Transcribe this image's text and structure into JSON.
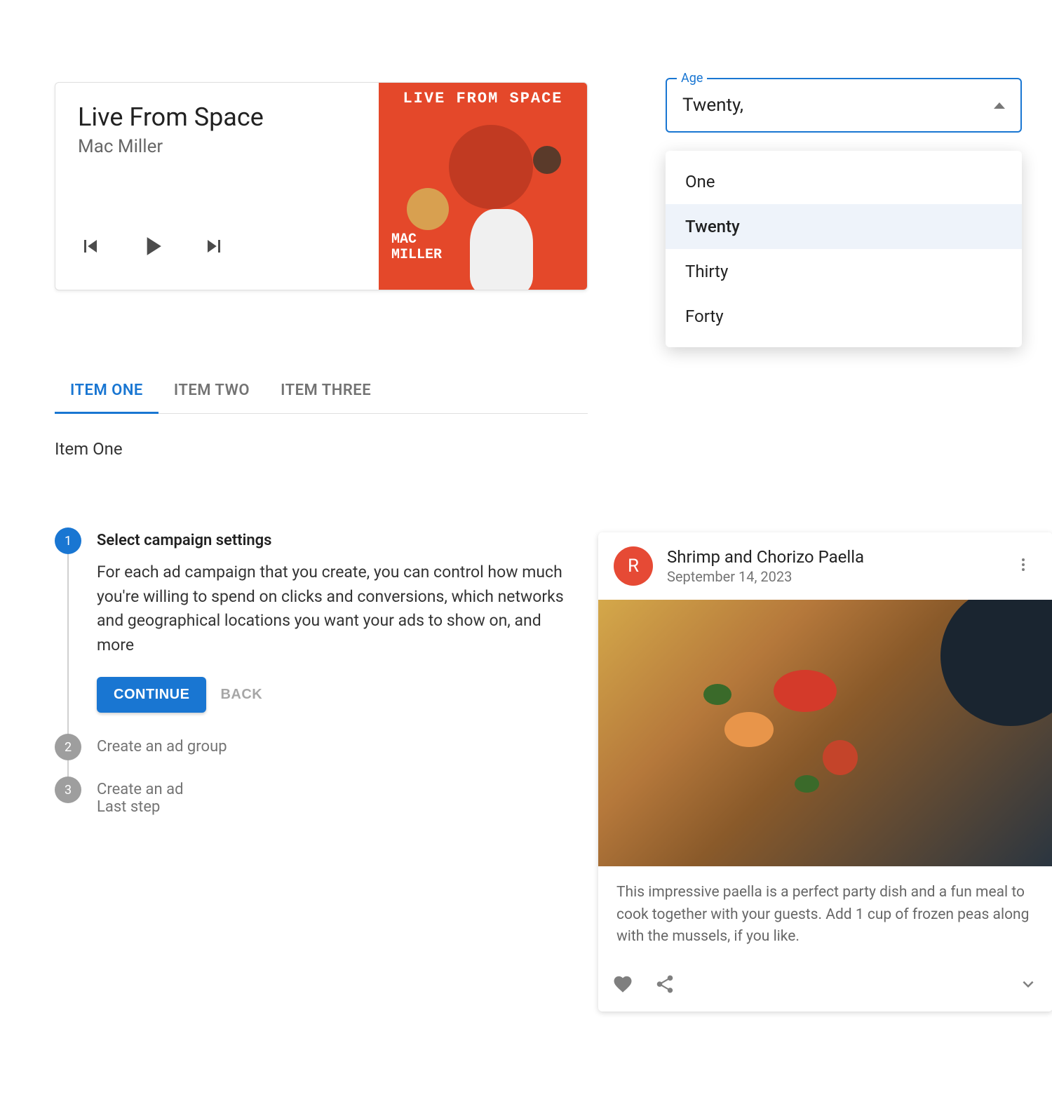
{
  "music": {
    "title": "Live From Space",
    "artist": "Mac Miller",
    "album_art_title": "LIVE FROM SPACE",
    "album_art_artist": "MAC\nMILLER"
  },
  "select": {
    "label": "Age",
    "value": "Twenty,",
    "options": [
      "One",
      "Twenty",
      "Thirty",
      "Forty"
    ],
    "selected_index": 1
  },
  "tabs": {
    "items": [
      "ITEM ONE",
      "ITEM TWO",
      "ITEM THREE"
    ],
    "active_index": 0,
    "panel": "Item One"
  },
  "stepper": {
    "steps": [
      {
        "num": "1",
        "title": "Select campaign settings",
        "content": "For each ad campaign that you create, you can control how much you're willing to spend on clicks and conversions, which networks and geographical locations you want your ads to show on, and more",
        "active": true
      },
      {
        "num": "2",
        "title": "Create an ad group"
      },
      {
        "num": "3",
        "title": "Create an ad",
        "subtitle": "Last step"
      }
    ],
    "continue_label": "CONTINUE",
    "back_label": "BACK"
  },
  "recipe": {
    "avatar_initial": "R",
    "title": "Shrimp and Chorizo Paella",
    "date": "September 14, 2023",
    "body": "This impressive paella is a perfect party dish and a fun meal to cook together with your guests. Add 1 cup of frozen peas along with the mussels, if you like."
  }
}
